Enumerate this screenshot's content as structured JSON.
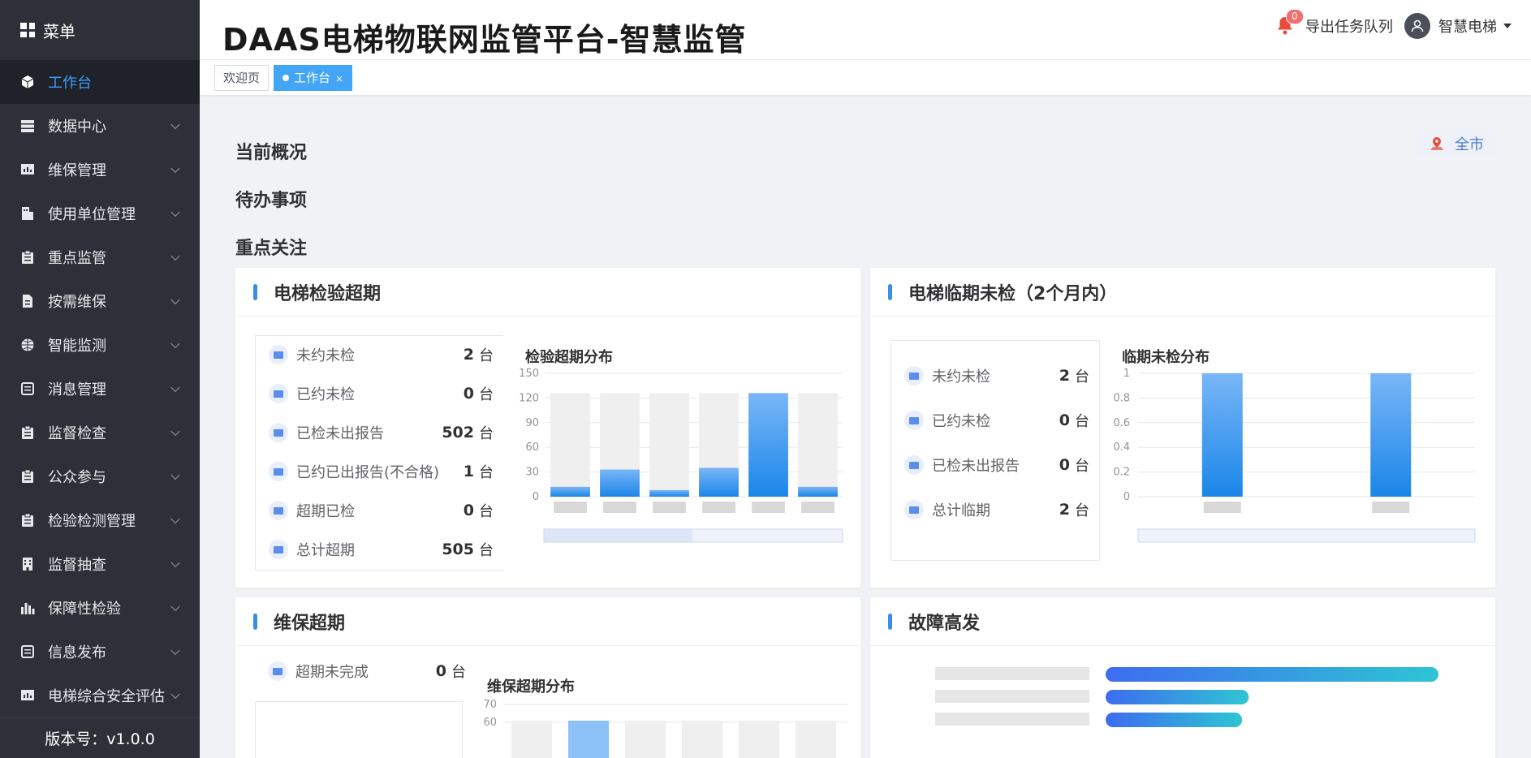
{
  "sidebar": {
    "header": "菜单",
    "items": [
      {
        "label": "工作台",
        "icon": "cube-icon",
        "active": true
      },
      {
        "label": "数据中心",
        "icon": "database-icon"
      },
      {
        "label": "维保管理",
        "icon": "chart-board-icon"
      },
      {
        "label": "使用单位管理",
        "icon": "building-icon"
      },
      {
        "label": "重点监管",
        "icon": "clipboard-icon"
      },
      {
        "label": "按需维保",
        "icon": "document-icon"
      },
      {
        "label": "智能监测",
        "icon": "globe-icon"
      },
      {
        "label": "消息管理",
        "icon": "message-list-icon"
      },
      {
        "label": "监督检查",
        "icon": "clipboard-icon"
      },
      {
        "label": "公众参与",
        "icon": "clipboard-icon"
      },
      {
        "label": "检验检测管理",
        "icon": "clipboard-icon"
      },
      {
        "label": "监督抽查",
        "icon": "office-icon"
      },
      {
        "label": "保障性检验",
        "icon": "bar-chart-icon"
      },
      {
        "label": "信息发布",
        "icon": "message-list-icon"
      },
      {
        "label": "电梯综合安全评估",
        "icon": "chart-board-icon"
      }
    ],
    "version": "版本号：v1.0.0"
  },
  "header": {
    "title": "DAAS电梯物联网监管平台-智慧监管",
    "notification_count": "0",
    "export_queue": "导出任务队列",
    "username": "智慧电梯"
  },
  "tabs": [
    {
      "label": "欢迎页",
      "active": false
    },
    {
      "label": "工作台",
      "active": true,
      "close": "×"
    }
  ],
  "main": {
    "overview_title": "当前概况",
    "todo_title": "待办事项",
    "focus_title": "重点关注",
    "region_button": "全市"
  },
  "cards": {
    "overdue_inspection": {
      "title": "电梯检验超期",
      "unit": "台",
      "stats": [
        {
          "label": "未约未检",
          "value": "2"
        },
        {
          "label": "已约未检",
          "value": "0"
        },
        {
          "label": "已检未出报告",
          "value": "502"
        },
        {
          "label": "已约已出报告(不合格)",
          "value": "1"
        },
        {
          "label": "超期已检",
          "value": "0"
        },
        {
          "label": "总计超期",
          "value": "505"
        }
      ],
      "chart_title": "检验超期分布"
    },
    "upcoming_inspection": {
      "title": "电梯临期未检（2个月内）",
      "unit": "台",
      "stats": [
        {
          "label": "未约未检",
          "value": "2"
        },
        {
          "label": "已约未检",
          "value": "0"
        },
        {
          "label": "已检未出报告",
          "value": "0"
        },
        {
          "label": "总计临期",
          "value": "2"
        }
      ],
      "chart_title": "临期未检分布"
    },
    "overdue_maintenance": {
      "title": "维保超期",
      "unit": "台",
      "stats": [
        {
          "label": "超期未完成",
          "value": "0"
        }
      ],
      "chart_title": "维保超期分布"
    },
    "fault_frequent": {
      "title": "故障高发"
    }
  },
  "chart_data": [
    {
      "type": "bar",
      "title": "检验超期分布",
      "categories": [
        "",
        "",
        "",
        "",
        "",
        ""
      ],
      "values": [
        12,
        33,
        8,
        35,
        126,
        12
      ],
      "background_max": 126,
      "ylim": [
        0,
        150
      ],
      "yticks": [
        0,
        30,
        60,
        90,
        120,
        150
      ],
      "colors": {
        "bar_top": "#79b6f7",
        "bar_bottom": "#1a86e8",
        "shadow": "#efefef"
      }
    },
    {
      "type": "bar",
      "title": "临期未检分布",
      "categories": [
        "",
        ""
      ],
      "values": [
        1,
        1
      ],
      "ylim": [
        0,
        1
      ],
      "yticks": [
        "0",
        "0.2",
        "0.4",
        "0.6",
        "0.8",
        "1"
      ],
      "colors": {
        "bar_top": "#79b6f7",
        "bar_bottom": "#1a86e8"
      }
    },
    {
      "type": "bar",
      "title": "维保超期分布",
      "ylim": [
        0,
        70
      ],
      "yticks": [
        "70",
        "60"
      ]
    },
    {
      "type": "bar",
      "title": "故障高发",
      "orientation": "horizontal",
      "values": [
        100,
        43,
        41
      ],
      "colors": {
        "start": "#3d6cf0",
        "end": "#2ec5d3"
      }
    }
  ],
  "colors": {
    "sidebar_bg": "#2d3038",
    "active_menu_text": "#3c9cff",
    "accent": "#42a5f5",
    "badge": "#f56c6c"
  }
}
